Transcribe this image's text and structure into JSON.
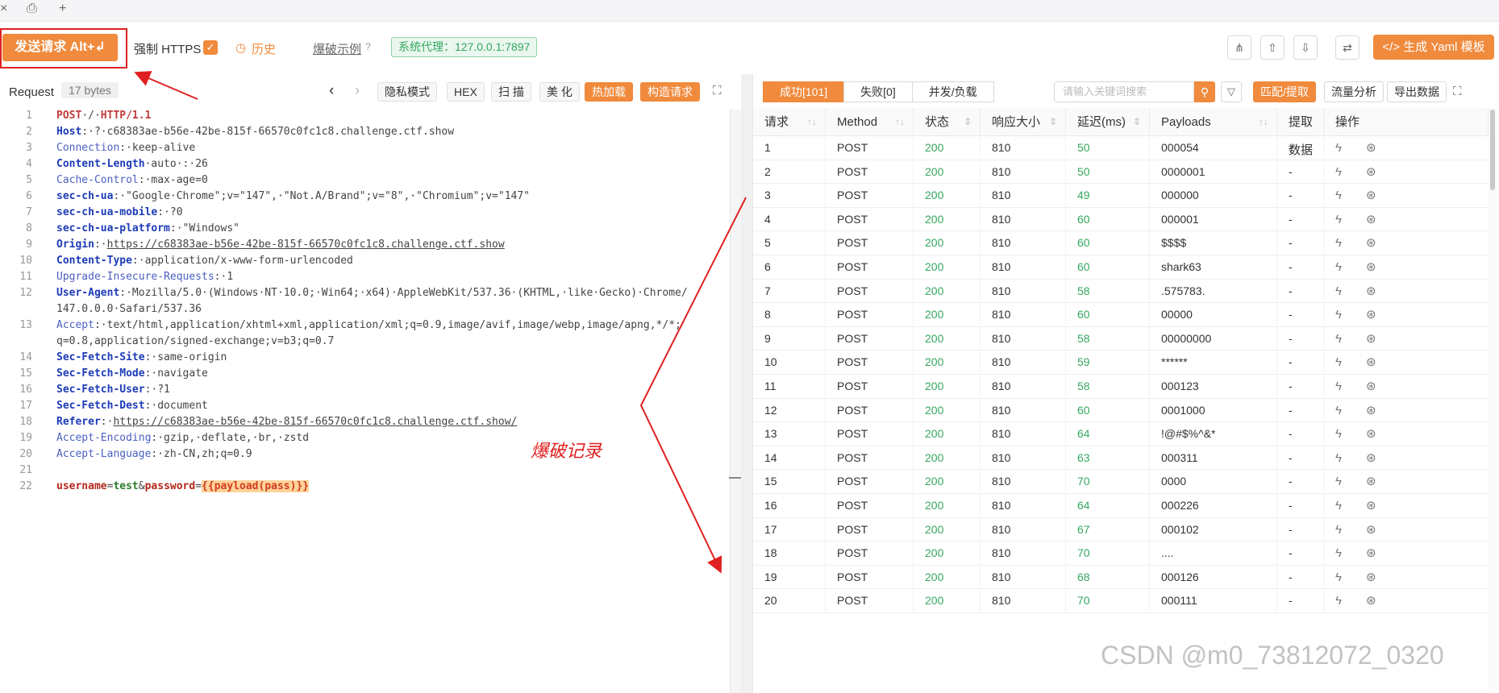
{
  "tabbar": {
    "close": "×",
    "save": "⎙",
    "add": "+"
  },
  "toolbar": {
    "send_label": "发送请求 Alt+↲",
    "https_label": "强制 HTTPS",
    "history_label": "历史",
    "burst_label": "爆破示例",
    "proxy_label": "系统代理：127.0.0.1:7897",
    "yaml_label": "生成 Yaml 模板"
  },
  "request": {
    "title": "Request",
    "size": "17 bytes",
    "buttons": {
      "privacy": "隐私模式",
      "hex": "HEX",
      "scan": "扫 描",
      "beautify": "美 化",
      "hotload": "热加载",
      "build": "构造请求"
    },
    "lines": [
      {
        "n": "1",
        "parts": [
          [
            "m",
            "POST"
          ],
          [
            "t",
            "·/·"
          ],
          [
            "m",
            "HTTP/1.1"
          ]
        ]
      },
      {
        "n": "2",
        "parts": [
          [
            "k",
            "Host"
          ],
          [
            "t",
            ":·"
          ],
          [
            "t",
            "?"
          ],
          [
            "t",
            "·c68383ae-b56e-42be-815f-66570c0fc1c8.challenge.ctf.show"
          ]
        ]
      },
      {
        "n": "3",
        "parts": [
          [
            "k2",
            "Connection"
          ],
          [
            "t",
            ":·keep-alive"
          ]
        ]
      },
      {
        "n": "4",
        "parts": [
          [
            "k",
            "Content-Length"
          ],
          [
            "t",
            "·auto·:·26"
          ]
        ]
      },
      {
        "n": "5",
        "parts": [
          [
            "k2",
            "Cache-Control"
          ],
          [
            "t",
            ":·max-age=0"
          ]
        ]
      },
      {
        "n": "6",
        "parts": [
          [
            "k",
            "sec-ch-ua"
          ],
          [
            "t",
            ":·\"Google·Chrome\";v=\"147\",·\"Not.A/Brand\";v=\"8\",·\"Chromium\";v=\"147\""
          ]
        ]
      },
      {
        "n": "7",
        "parts": [
          [
            "k",
            "sec-ch-ua-mobile"
          ],
          [
            "t",
            ":·?0"
          ]
        ]
      },
      {
        "n": "8",
        "parts": [
          [
            "k",
            "sec-ch-ua-platform"
          ],
          [
            "t",
            ":·\"Windows\""
          ]
        ]
      },
      {
        "n": "9",
        "parts": [
          [
            "k",
            "Origin"
          ],
          [
            "t",
            ":·"
          ],
          [
            "u",
            "https://c68383ae-b56e-42be-815f-66570c0fc1c8.challenge.ctf.show"
          ]
        ]
      },
      {
        "n": "10",
        "parts": [
          [
            "k",
            "Content-Type"
          ],
          [
            "t",
            ":·application/x-www-form-urlencoded"
          ]
        ]
      },
      {
        "n": "11",
        "parts": [
          [
            "k2",
            "Upgrade-Insecure-Requests"
          ],
          [
            "t",
            ":·1"
          ]
        ]
      },
      {
        "n": "12",
        "parts": [
          [
            "k",
            "User-Agent"
          ],
          [
            "t",
            ":·Mozilla/5.0·(Windows·NT·10.0;·Win64;·x64)·AppleWebKit/537.36·(KHTML,·like·Gecko)·Chrome/"
          ]
        ]
      },
      {
        "n": "",
        "parts": [
          [
            "t",
            "147.0.0.0·Safari/537.36"
          ]
        ]
      },
      {
        "n": "13",
        "parts": [
          [
            "k2",
            "Accept"
          ],
          [
            "t",
            ":·text/html,application/xhtml+xml,application/xml;q=0.9,image/avif,image/webp,image/apng,*/*;"
          ]
        ]
      },
      {
        "n": "",
        "parts": [
          [
            "t",
            "q=0.8,application/signed-exchange;v=b3;q=0.7"
          ]
        ]
      },
      {
        "n": "14",
        "parts": [
          [
            "k",
            "Sec-Fetch-Site"
          ],
          [
            "t",
            ":·same-origin"
          ]
        ]
      },
      {
        "n": "15",
        "parts": [
          [
            "k",
            "Sec-Fetch-Mode"
          ],
          [
            "t",
            ":·navigate"
          ]
        ]
      },
      {
        "n": "16",
        "parts": [
          [
            "k",
            "Sec-Fetch-User"
          ],
          [
            "t",
            ":·?1"
          ]
        ]
      },
      {
        "n": "17",
        "parts": [
          [
            "k",
            "Sec-Fetch-Dest"
          ],
          [
            "t",
            ":·document"
          ]
        ]
      },
      {
        "n": "18",
        "parts": [
          [
            "k",
            "Referer"
          ],
          [
            "t",
            ":·"
          ],
          [
            "u",
            "https://c68383ae-b56e-42be-815f-66570c0fc1c8.challenge.ctf.show/"
          ]
        ]
      },
      {
        "n": "19",
        "parts": [
          [
            "k2",
            "Accept-Encoding"
          ],
          [
            "t",
            ":·gzip,·deflate,·br,·zstd"
          ]
        ]
      },
      {
        "n": "20",
        "parts": [
          [
            "k2",
            "Accept-Language"
          ],
          [
            "t",
            ":·zh-CN,zh;q=0.9"
          ]
        ]
      },
      {
        "n": "21",
        "parts": []
      },
      {
        "n": "22",
        "parts": [
          [
            "pk",
            "username"
          ],
          [
            "t",
            "="
          ],
          [
            "pv",
            "test"
          ],
          [
            "t",
            "&"
          ],
          [
            "pk",
            "password"
          ],
          [
            "t",
            "="
          ],
          [
            "pl",
            "{{payload(pass)}}"
          ]
        ]
      }
    ]
  },
  "annotation": "爆破记录",
  "results": {
    "tabs": [
      "成功[101]",
      "失败[0]",
      "并发/负载"
    ],
    "search_placeholder": "请输入关键词搜索",
    "buttons": {
      "match": "匹配/提取",
      "traffic": "流量分析",
      "export": "导出数据"
    },
    "columns": [
      "请求",
      "Method",
      "状态",
      "响应大小",
      "延迟(ms)",
      "Payloads",
      "提取数据",
      "操作"
    ],
    "rows": [
      [
        "1",
        "POST",
        "200",
        "810",
        "50",
        "000054",
        "-"
      ],
      [
        "2",
        "POST",
        "200",
        "810",
        "50",
        "0000001",
        "-"
      ],
      [
        "3",
        "POST",
        "200",
        "810",
        "49",
        "000000",
        "-"
      ],
      [
        "4",
        "POST",
        "200",
        "810",
        "60",
        "000001",
        "-"
      ],
      [
        "5",
        "POST",
        "200",
        "810",
        "60",
        "$$$$",
        "-"
      ],
      [
        "6",
        "POST",
        "200",
        "810",
        "60",
        "shark63",
        "-"
      ],
      [
        "7",
        "POST",
        "200",
        "810",
        "58",
        ".575783.",
        "-"
      ],
      [
        "8",
        "POST",
        "200",
        "810",
        "60",
        "00000",
        "-"
      ],
      [
        "9",
        "POST",
        "200",
        "810",
        "58",
        "00000000",
        "-"
      ],
      [
        "10",
        "POST",
        "200",
        "810",
        "59",
        "******",
        "-"
      ],
      [
        "11",
        "POST",
        "200",
        "810",
        "58",
        "000123",
        "-"
      ],
      [
        "12",
        "POST",
        "200",
        "810",
        "60",
        "0001000",
        "-"
      ],
      [
        "13",
        "POST",
        "200",
        "810",
        "64",
        "!@#$%^&*",
        "-"
      ],
      [
        "14",
        "POST",
        "200",
        "810",
        "63",
        "000311",
        "-"
      ],
      [
        "15",
        "POST",
        "200",
        "810",
        "70",
        "0000",
        "-"
      ],
      [
        "16",
        "POST",
        "200",
        "810",
        "64",
        "000226",
        "-"
      ],
      [
        "17",
        "POST",
        "200",
        "810",
        "67",
        "000102",
        "-"
      ],
      [
        "18",
        "POST",
        "200",
        "810",
        "70",
        "....",
        "-"
      ],
      [
        "19",
        "POST",
        "200",
        "810",
        "68",
        "000126",
        "-"
      ],
      [
        "20",
        "POST",
        "200",
        "810",
        "70",
        "000111",
        "-"
      ]
    ]
  },
  "watermark": "CSDN @m0_73812072_0320",
  "colors": {
    "accent": "#f08a3c",
    "success": "#36a760",
    "annotation": "#e02020"
  }
}
